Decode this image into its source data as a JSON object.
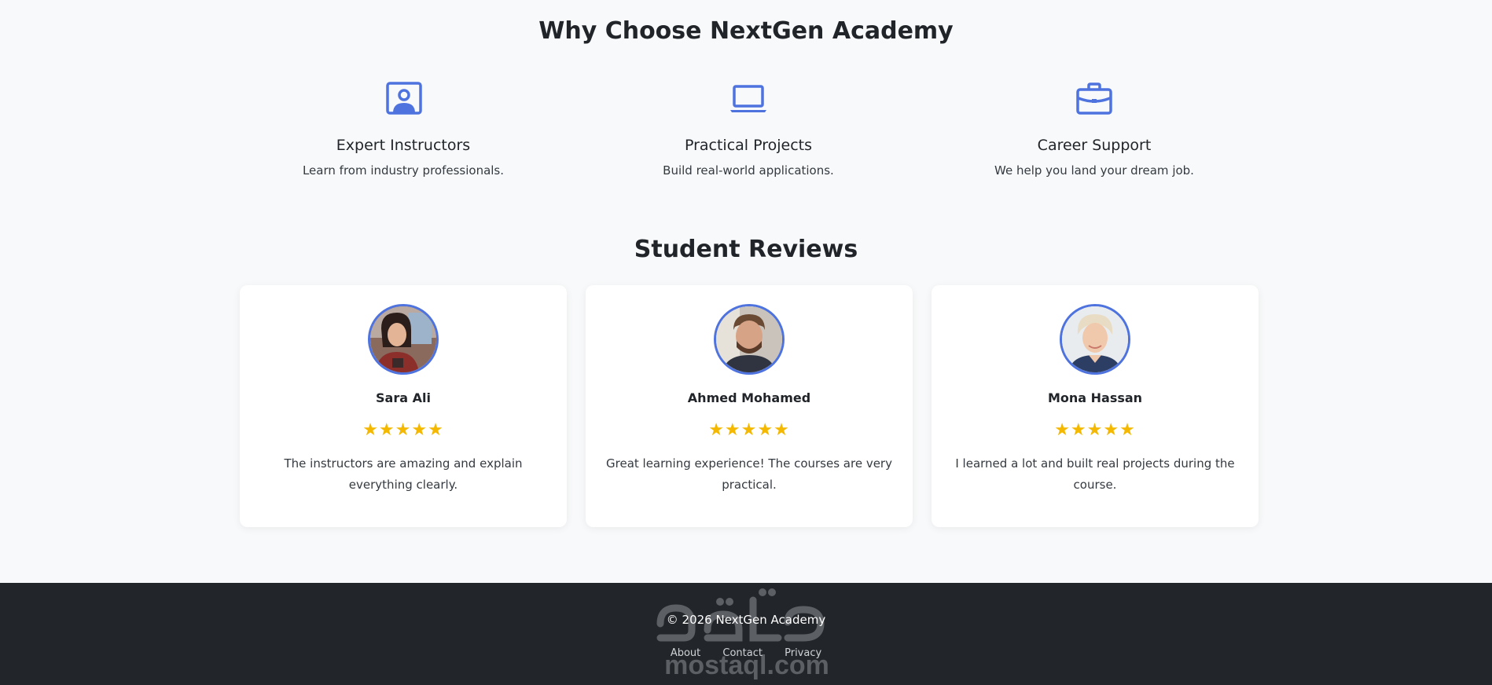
{
  "why_section": {
    "title": "Why Choose NextGen Academy",
    "features": [
      {
        "icon": "person-video-icon",
        "title": "Expert Instructors",
        "text": "Learn from industry professionals."
      },
      {
        "icon": "laptop-icon",
        "title": "Practical Projects",
        "text": "Build real-world applications."
      },
      {
        "icon": "briefcase-icon",
        "title": "Career Support",
        "text": "We help you land your dream job."
      }
    ]
  },
  "reviews_section": {
    "title": "Student Reviews",
    "reviews": [
      {
        "name": "Sara Ali",
        "stars": "★★★★★",
        "rating": 5,
        "text": "The instructors are amazing and explain everything clearly."
      },
      {
        "name": "Ahmed Mohamed",
        "stars": "★★★★★",
        "rating": 5,
        "text": "Great learning experience! The courses are very practical."
      },
      {
        "name": "Mona Hassan",
        "stars": "★★★★★",
        "rating": 5,
        "text": "I learned a lot and built real projects during the course."
      }
    ]
  },
  "footer": {
    "copyright": "© 2026 NextGen Academy",
    "links": [
      "About",
      "Contact",
      "Privacy"
    ],
    "watermark_text": "mostaql.com"
  },
  "colors": {
    "accent": "#4e73df",
    "star": "#f5b800",
    "footer_bg": "#222529",
    "page_bg": "#f8f9fa"
  }
}
